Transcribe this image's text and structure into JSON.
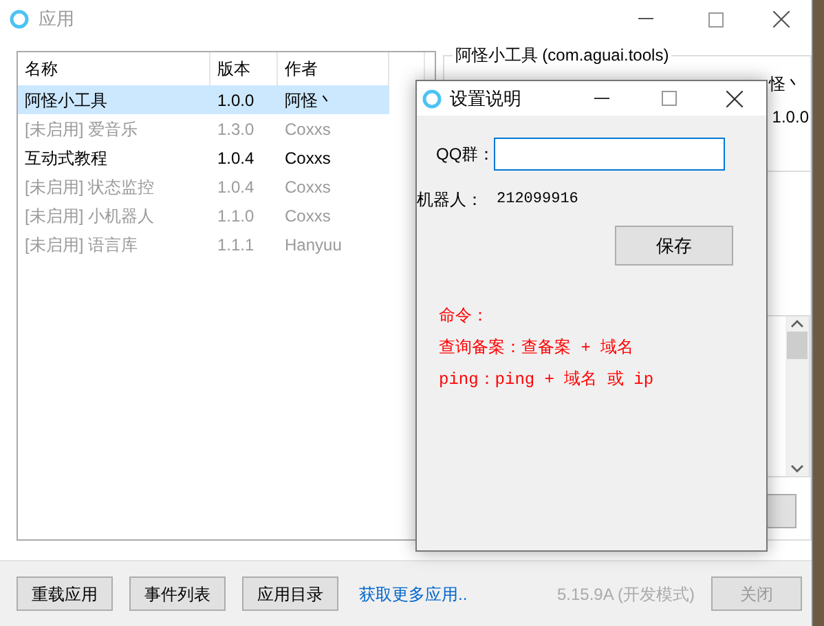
{
  "main_window": {
    "title": "应用",
    "table": {
      "columns": [
        "名称",
        "版本",
        "作者"
      ],
      "rows": [
        {
          "name": "阿怪小工具",
          "version": "1.0.0",
          "author": "阿怪丶",
          "selected": true,
          "disabled": false
        },
        {
          "name": "[未启用] 爱音乐",
          "version": "1.3.0",
          "author": "Coxxs",
          "selected": false,
          "disabled": true
        },
        {
          "name": "互动式教程",
          "version": "1.0.4",
          "author": "Coxxs",
          "selected": false,
          "disabled": false
        },
        {
          "name": "[未启用] 状态监控",
          "version": "1.0.4",
          "author": "Coxxs",
          "selected": false,
          "disabled": true
        },
        {
          "name": "[未启用] 小机器人",
          "version": "1.1.0",
          "author": "Coxxs",
          "selected": false,
          "disabled": true
        },
        {
          "name": "[未启用] 语言库",
          "version": "1.1.1",
          "author": "Hanyuu",
          "selected": false,
          "disabled": true
        }
      ]
    },
    "details": {
      "title": "阿怪小工具 (com.aguai.tools)",
      "author": "怪丶",
      "version": "1.0.0"
    },
    "footer": {
      "buttons": [
        "重载应用",
        "事件列表",
        "应用目录"
      ],
      "link": "获取更多应用..",
      "version": "5.15.9A (开发模式)",
      "close": "关闭"
    }
  },
  "dialog": {
    "title": "设置说明",
    "qq_label": "QQ群：",
    "robot_label": "机器人：",
    "robot_value": "212099916",
    "save": "保存",
    "notes": [
      "命令：",
      "查询备案：查备案 + 域名",
      "ping：ping + 域名 或 ip"
    ]
  }
}
